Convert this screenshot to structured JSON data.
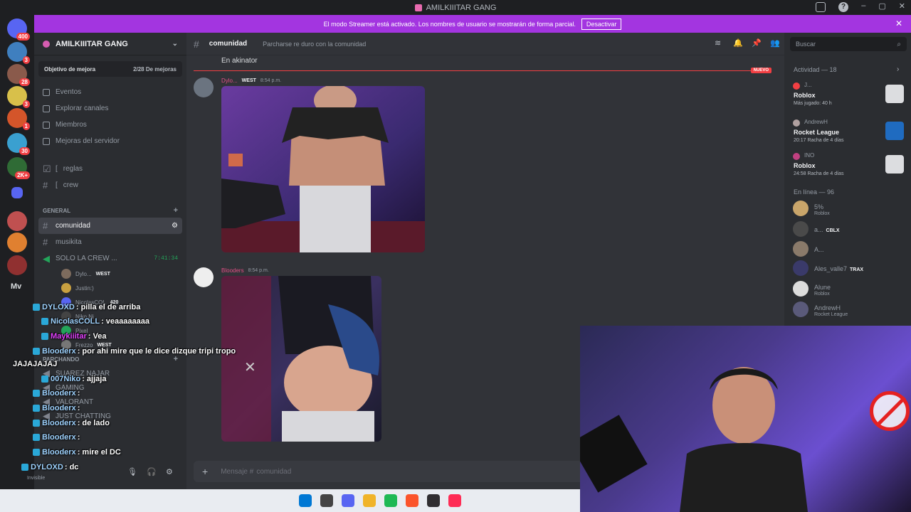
{
  "window": {
    "title": "AMILKIIITAR GANG"
  },
  "banner": {
    "text": "El modo Streamer está activado. Los nombres de usuario se mostrarán de forma parcial.",
    "button_label": "Desactivar",
    "close_glyph": "✕"
  },
  "servers": {
    "items": [
      {
        "icon": "discord-home-icon",
        "badge": "400",
        "color": "#5865f2"
      },
      {
        "icon": "server-avatar-icon",
        "badge": "3",
        "color": "#3f7fbf"
      },
      {
        "icon": "server-avatar-icon",
        "badge": "28",
        "color": "#8a5a4b"
      },
      {
        "icon": "server-avatar-icon",
        "badge": "3",
        "color": "#d8c04a"
      },
      {
        "icon": "server-avatar-icon",
        "badge": "1",
        "color": "#d4552a"
      },
      {
        "icon": "server-avatar-icon",
        "badge": "30",
        "color": "#3aa0d0"
      },
      {
        "icon": "server-avatar-icon",
        "badge": "2K+",
        "color": "#2f6b35"
      },
      {
        "icon": "folder-icon",
        "badge": "",
        "color": "#5865f2"
      },
      {
        "icon": "server-avatar-icon",
        "badge": "",
        "color": "#c05050"
      },
      {
        "icon": "server-avatar-icon",
        "badge": "",
        "color": "#e08030"
      },
      {
        "icon": "server-avatar-icon",
        "badge": "",
        "color": "#903030"
      },
      {
        "icon": "server-avatar-icon",
        "badge": "",
        "color": "#2a5aa0"
      }
    ],
    "mv_label": "Mv"
  },
  "sidebar": {
    "server_name": "AMILKIIITAR GANG",
    "goal_label": "Objetivo de mejora",
    "goal_count": "2/28 De mejoras",
    "nav": [
      {
        "label": "Eventos",
        "icon": "calendar-icon"
      },
      {
        "label": "Explorar canales",
        "icon": "browse-channels-icon"
      },
      {
        "label": "Miembros",
        "icon": "members-icon"
      },
      {
        "label": "Mejoras del servidor",
        "icon": "boost-icon"
      }
    ],
    "channels_top": [
      {
        "label": "reglas",
        "prefix": "["
      },
      {
        "label": "crew",
        "prefix": "["
      }
    ],
    "category_general": "GENERAL",
    "channel_active": "comunidad",
    "channel_music": "musikita",
    "channel_voice": "SOLO LA CREW ...",
    "voice_timer": "7:41:34",
    "voice_users": [
      {
        "name": "Dylo...",
        "tag": "WEST"
      },
      {
        "name": "Justin:)",
        "tag": ""
      },
      {
        "name": "NicolasCOL",
        "tag": "420"
      },
      {
        "name": "Niko Ni",
        "tag": ""
      },
      {
        "name": "Pixel",
        "tag": ""
      },
      {
        "name": "Frezzo",
        "tag": "WEST"
      }
    ],
    "category_parchando": "PARCHANDO",
    "parchando_channels": [
      "SUAREZ NAJAR",
      "GAMING",
      "VALORANT",
      "JUST CHATTING"
    ],
    "user_status": "Invisible"
  },
  "chat": {
    "channel_name": "comunidad",
    "topic": "Parcharse re duro con la comunidad",
    "system_text": "En akinator",
    "new_label": "NUEVO",
    "messages": [
      {
        "author": "Dylo...",
        "tag": "WEST",
        "time": "8:54 p.m."
      },
      {
        "author": "Blooders",
        "tag": "",
        "time": "8:54 p.m."
      }
    ],
    "composer_placeholder": "Mensaje #",
    "composer_channel": "comunidad"
  },
  "members": {
    "search_placeholder": "Buscar",
    "activity_title": "Actividad — 18",
    "activities": [
      {
        "user": "J...",
        "game": "Roblox",
        "sub": "Más jugado: 40 h"
      },
      {
        "user": "AndrewH",
        "game": "Rocket League",
        "sub": "20:17  Racha de 4 días"
      },
      {
        "user": "INO",
        "game": "Roblox",
        "sub": "24:58  Racha de 4 días"
      }
    ],
    "online_title": "En línea — 96",
    "list": [
      {
        "name": "5%",
        "sub": "Roblox",
        "tag": "",
        "color": "#c9a56a"
      },
      {
        "name": "a...",
        "sub": "",
        "tag": "CBLX",
        "color": "#4a4a4a"
      },
      {
        "name": "A...",
        "sub": "",
        "tag": "",
        "color": "#8a7a6a"
      },
      {
        "name": "Ales_valle7",
        "sub": "",
        "tag": "TRAX",
        "color": "#3a3a6a"
      },
      {
        "name": "Alune",
        "sub": "Roblox",
        "tag": "",
        "color": "#dcdcdc"
      },
      {
        "name": "AndrewH",
        "sub": "Rocket League",
        "tag": "",
        "color": "#5a5a7a"
      }
    ]
  },
  "stream_chat": [
    {
      "user": "DYLOXD",
      "text": ": pilla el de arriba",
      "color": "b"
    },
    {
      "user": "NicolasCOLL",
      "text": ": veaaaaaaaa",
      "color": "b"
    },
    {
      "user": "Maykiiitar",
      "text": ": Vea",
      "color": "p"
    },
    {
      "user": "Blooderx",
      "text": ": por ahi mire que le dice dizque tripi tropo",
      "color": "b"
    },
    {
      "user": "",
      "text": "JAJAJAJAJ",
      "color": "b"
    },
    {
      "user": "007Niko",
      "text": ": ajjaja",
      "color": "b"
    },
    {
      "user": "Blooderx",
      "text": ":",
      "color": "b"
    },
    {
      "user": "Blooderx",
      "text": ":",
      "color": "b"
    },
    {
      "user": "Blooderx",
      "text": ": de lado",
      "color": "b"
    },
    {
      "user": "Blooderx",
      "text": ":",
      "color": "b"
    },
    {
      "user": "Blooderx",
      "text": ": mire el DC",
      "color": "b"
    },
    {
      "user": "DYLOXD",
      "text": ": dc",
      "color": "b"
    }
  ],
  "taskbar": {
    "apps": [
      {
        "icon": "windows-start-icon",
        "color": "#0078d4"
      },
      {
        "icon": "search-icon",
        "color": "#444"
      },
      {
        "icon": "discord-icon",
        "color": "#5865f2"
      },
      {
        "icon": "file-explorer-icon",
        "color": "#f0b429"
      },
      {
        "icon": "spotify-icon",
        "color": "#1db954"
      },
      {
        "icon": "brave-icon",
        "color": "#fb542b"
      },
      {
        "icon": "obs-icon",
        "color": "#302e31"
      },
      {
        "icon": "tiktok-icon",
        "color": "#fe2c55"
      }
    ]
  }
}
